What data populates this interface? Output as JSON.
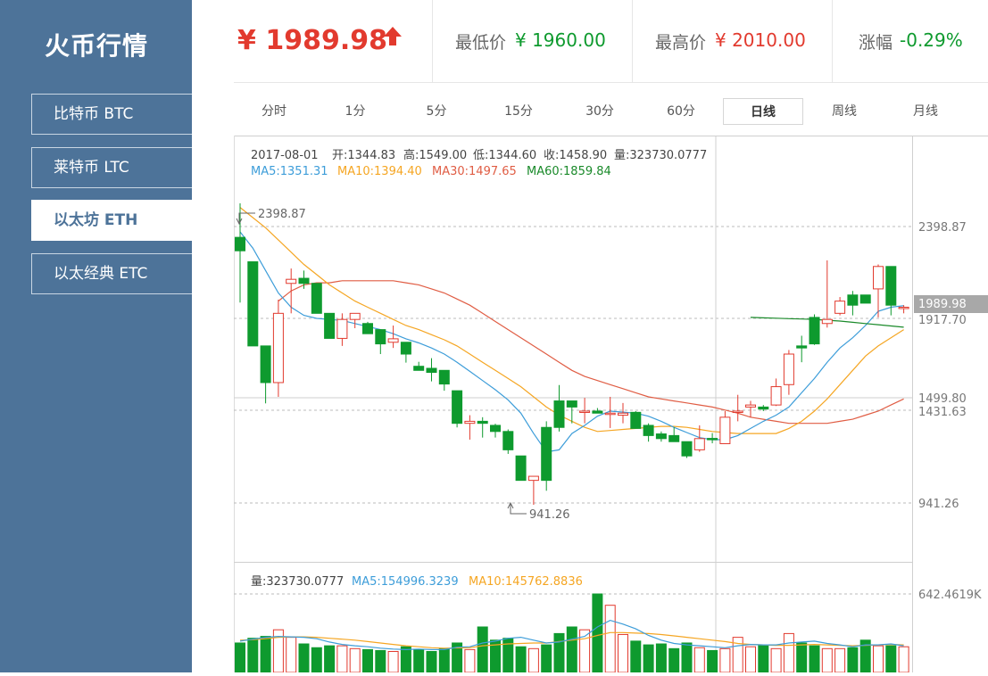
{
  "app": {
    "title": "火币行情"
  },
  "sidebar": {
    "items": [
      {
        "label": "比特币 BTC",
        "active": false
      },
      {
        "label": "莱特币 LTC",
        "active": false
      },
      {
        "label": "以太坊 ETH",
        "active": true
      },
      {
        "label": "以太经典 ETC",
        "active": false
      }
    ]
  },
  "stats": {
    "price": "¥ 1989.98",
    "low_label": "最低价",
    "low_value": "¥ 1960.00",
    "high_label": "最高价",
    "high_value": "¥ 2010.00",
    "change_label": "涨幅",
    "change_value": "-0.29%"
  },
  "tabs": [
    {
      "label": "分时",
      "active": false
    },
    {
      "label": "1分",
      "active": false
    },
    {
      "label": "5分",
      "active": false
    },
    {
      "label": "15分",
      "active": false
    },
    {
      "label": "30分",
      "active": false
    },
    {
      "label": "60分",
      "active": false
    },
    {
      "label": "日线",
      "active": true
    },
    {
      "label": "周线",
      "active": false
    },
    {
      "label": "月线",
      "active": false
    }
  ],
  "colors": {
    "sidebar": "#4d7399",
    "up": "#e23a2e",
    "down": "#0e9a2e",
    "ma5": "#3d9dd9",
    "ma10": "#f5a623",
    "ma30": "#e05d44",
    "ma60": "#1a8a2a"
  },
  "chart_data": {
    "type": "candlestick",
    "info": {
      "date": "2017-08-01",
      "open": "开:1344.83",
      "high": "高:1549.00",
      "low": "低:1344.60",
      "close": "收:1458.90",
      "volume": "量:323730.0777"
    },
    "ma_labels": {
      "ma5": "MA5:1351.31",
      "ma10": "MA10:1394.40",
      "ma30": "MA30:1497.65",
      "ma60": "MA60:1859.84"
    },
    "y_ticks": [
      "2398.87",
      "1917.70",
      "1431.63",
      "941.26"
    ],
    "price_ylim": [
      740,
      2570
    ],
    "current_price": "1989.98",
    "cursor_price": "1499.80",
    "max_label": "2398.87",
    "min_label": "941.26",
    "candles": [
      [
        2333,
        2267,
        2500,
        2013
      ],
      [
        2213,
        1800,
        2213,
        1800
      ],
      [
        1800,
        1620,
        1800,
        1518
      ],
      [
        1620,
        1960,
        2027,
        1550
      ],
      [
        2107,
        2127,
        2180,
        1960
      ],
      [
        2132,
        2107,
        2170,
        2080
      ],
      [
        2107,
        1960,
        2107,
        1960
      ],
      [
        1960,
        1837,
        1960,
        1837
      ],
      [
        1837,
        1930,
        1960,
        1800
      ],
      [
        1930,
        1960,
        1960,
        1887
      ],
      [
        1910,
        1860,
        1918,
        1860
      ],
      [
        1880,
        1810,
        1880,
        1760
      ],
      [
        1818,
        1835,
        1900,
        1790
      ],
      [
        1818,
        1760,
        1818,
        1718
      ],
      [
        1700,
        1680,
        1722,
        1680
      ],
      [
        1690,
        1670,
        1740,
        1626
      ],
      [
        1680,
        1613,
        1680,
        1580
      ],
      [
        1580,
        1420,
        1580,
        1400
      ],
      [
        1420,
        1430,
        1460,
        1340
      ],
      [
        1430,
        1420,
        1450,
        1350
      ],
      [
        1410,
        1380,
        1418,
        1350
      ],
      [
        1380,
        1290,
        1390,
        1270
      ],
      [
        1260,
        1140,
        1260,
        1140
      ],
      [
        1140,
        1160,
        1160,
        1020
      ],
      [
        1400,
        1140,
        1430,
        1089
      ],
      [
        1530,
        1400,
        1608,
        1380
      ],
      [
        1530,
        1500,
        1530,
        1420
      ],
      [
        1480,
        1480,
        1545,
        1420
      ],
      [
        1480,
        1470,
        1495,
        1470
      ],
      [
        1470,
        1470,
        1550,
        1397
      ],
      [
        1460,
        1470,
        1520,
        1420
      ],
      [
        1474,
        1395,
        1480,
        1395
      ],
      [
        1410,
        1360,
        1420,
        1330
      ],
      [
        1368,
        1345,
        1380,
        1330
      ],
      [
        1360,
        1330,
        1400,
        1330
      ],
      [
        1330,
        1260,
        1330,
        1250
      ],
      [
        1290,
        1345,
        1410,
        1280
      ],
      [
        1346,
        1340,
        1372,
        1322
      ],
      [
        1320,
        1450,
        1480,
        1320
      ],
      [
        1480,
        1480,
        1560,
        1430
      ],
      [
        1500,
        1510,
        1530,
        1450
      ],
      [
        1500,
        1490,
        1510,
        1480
      ],
      [
        1510,
        1600,
        1640,
        1505
      ],
      [
        1610,
        1760,
        1780,
        1560
      ],
      [
        1800,
        1790,
        1850,
        1720
      ],
      [
        1940,
        1810,
        1955,
        1805
      ],
      [
        1910,
        1930,
        2220,
        1890
      ],
      [
        1960,
        2020,
        2040,
        1950
      ],
      [
        2050,
        2000,
        2070,
        1950
      ],
      [
        2050,
        2010,
        2050,
        2010
      ],
      [
        2080,
        2190,
        2200,
        1940
      ],
      [
        2190,
        2000,
        2190,
        1950
      ],
      [
        1990,
        1990,
        2000,
        1960
      ]
    ],
    "ma5": [
      2360,
      2280,
      2170,
      2060,
      1990,
      1950,
      1935,
      1930,
      1925,
      1910,
      1895,
      1880,
      1860,
      1835,
      1815,
      1790,
      1760,
      1720,
      1675,
      1630,
      1585,
      1535,
      1470,
      1370,
      1280,
      1290,
      1370,
      1410,
      1455,
      1480,
      1475,
      1470,
      1455,
      1430,
      1400,
      1375,
      1350,
      1340,
      1340,
      1360,
      1395,
      1430,
      1460,
      1500,
      1570,
      1640,
      1720,
      1790,
      1840,
      1900,
      1970,
      1990,
      1998
    ],
    "ma10": [
      2480,
      2430,
      2380,
      2320,
      2260,
      2200,
      2150,
      2100,
      2060,
      2020,
      1990,
      1960,
      1930,
      1900,
      1880,
      1855,
      1830,
      1800,
      1760,
      1720,
      1680,
      1640,
      1600,
      1550,
      1500,
      1460,
      1430,
      1400,
      1380,
      1385,
      1390,
      1395,
      1400,
      1405,
      1405,
      1400,
      1390,
      1380,
      1375,
      1370,
      1370,
      1370,
      1370,
      1395,
      1430,
      1480,
      1540,
      1610,
      1680,
      1750,
      1800,
      1840,
      1880
    ],
    "ma30": [
      null,
      null,
      null,
      2020,
      2070,
      2100,
      2110,
      2110,
      2120,
      2120,
      2120,
      2120,
      2120,
      2110,
      2100,
      2080,
      2060,
      2030,
      2000,
      1960,
      1920,
      1880,
      1840,
      1800,
      1760,
      1720,
      1680,
      1650,
      1630,
      1610,
      1590,
      1570,
      1550,
      1540,
      1530,
      1520,
      1510,
      1500,
      1485,
      1470,
      1450,
      1440,
      1430,
      1420,
      1420,
      1420,
      1420,
      1430,
      1440,
      1460,
      1480,
      1510,
      1540
    ],
    "ma60": [
      1940,
      1938,
      1936,
      1934,
      1932,
      1930,
      1926,
      1922,
      1916,
      1910,
      1904,
      1898,
      1892
    ],
    "volume_info": {
      "vol": "量:323730.0777",
      "ma5": "MA5:154996.3239",
      "ma10": "MA10:145762.8836",
      "max_tick": "642.4619K"
    },
    "volume_ylim": [
      0,
      700
    ],
    "volumes": [
      180,
      230,
      250,
      320,
      240,
      170,
      130,
      150,
      150,
      120,
      110,
      100,
      90,
      140,
      110,
      90,
      120,
      180,
      110,
      350,
      210,
      230,
      140,
      120,
      160,
      280,
      350,
      320,
      700,
      580,
      270,
      200,
      160,
      170,
      120,
      180,
      130,
      100,
      120,
      240,
      140,
      160,
      120,
      280,
      180,
      150,
      120,
      120,
      130,
      210,
      150,
      150,
      140
    ],
    "vol_ma5": [
      200,
      220,
      240,
      250,
      245,
      240,
      225,
      190,
      165,
      150,
      140,
      125,
      115,
      110,
      115,
      110,
      110,
      135,
      140,
      180,
      200,
      230,
      240,
      210,
      180,
      190,
      220,
      250,
      350,
      420,
      380,
      330,
      260,
      210,
      175,
      160,
      150,
      140,
      130,
      150,
      165,
      160,
      160,
      180,
      190,
      200,
      175,
      160,
      140,
      160,
      160,
      170,
      150
    ],
    "vol_ma10": [
      210,
      215,
      225,
      240,
      245,
      245,
      240,
      230,
      220,
      210,
      195,
      180,
      165,
      150,
      140,
      130,
      125,
      128,
      130,
      150,
      160,
      170,
      175,
      180,
      180,
      195,
      210,
      225,
      260,
      290,
      290,
      285,
      280,
      270,
      255,
      240,
      225,
      210,
      195,
      175,
      165,
      160,
      155,
      155,
      160,
      165,
      160,
      155,
      150,
      155,
      160,
      165,
      160
    ]
  }
}
